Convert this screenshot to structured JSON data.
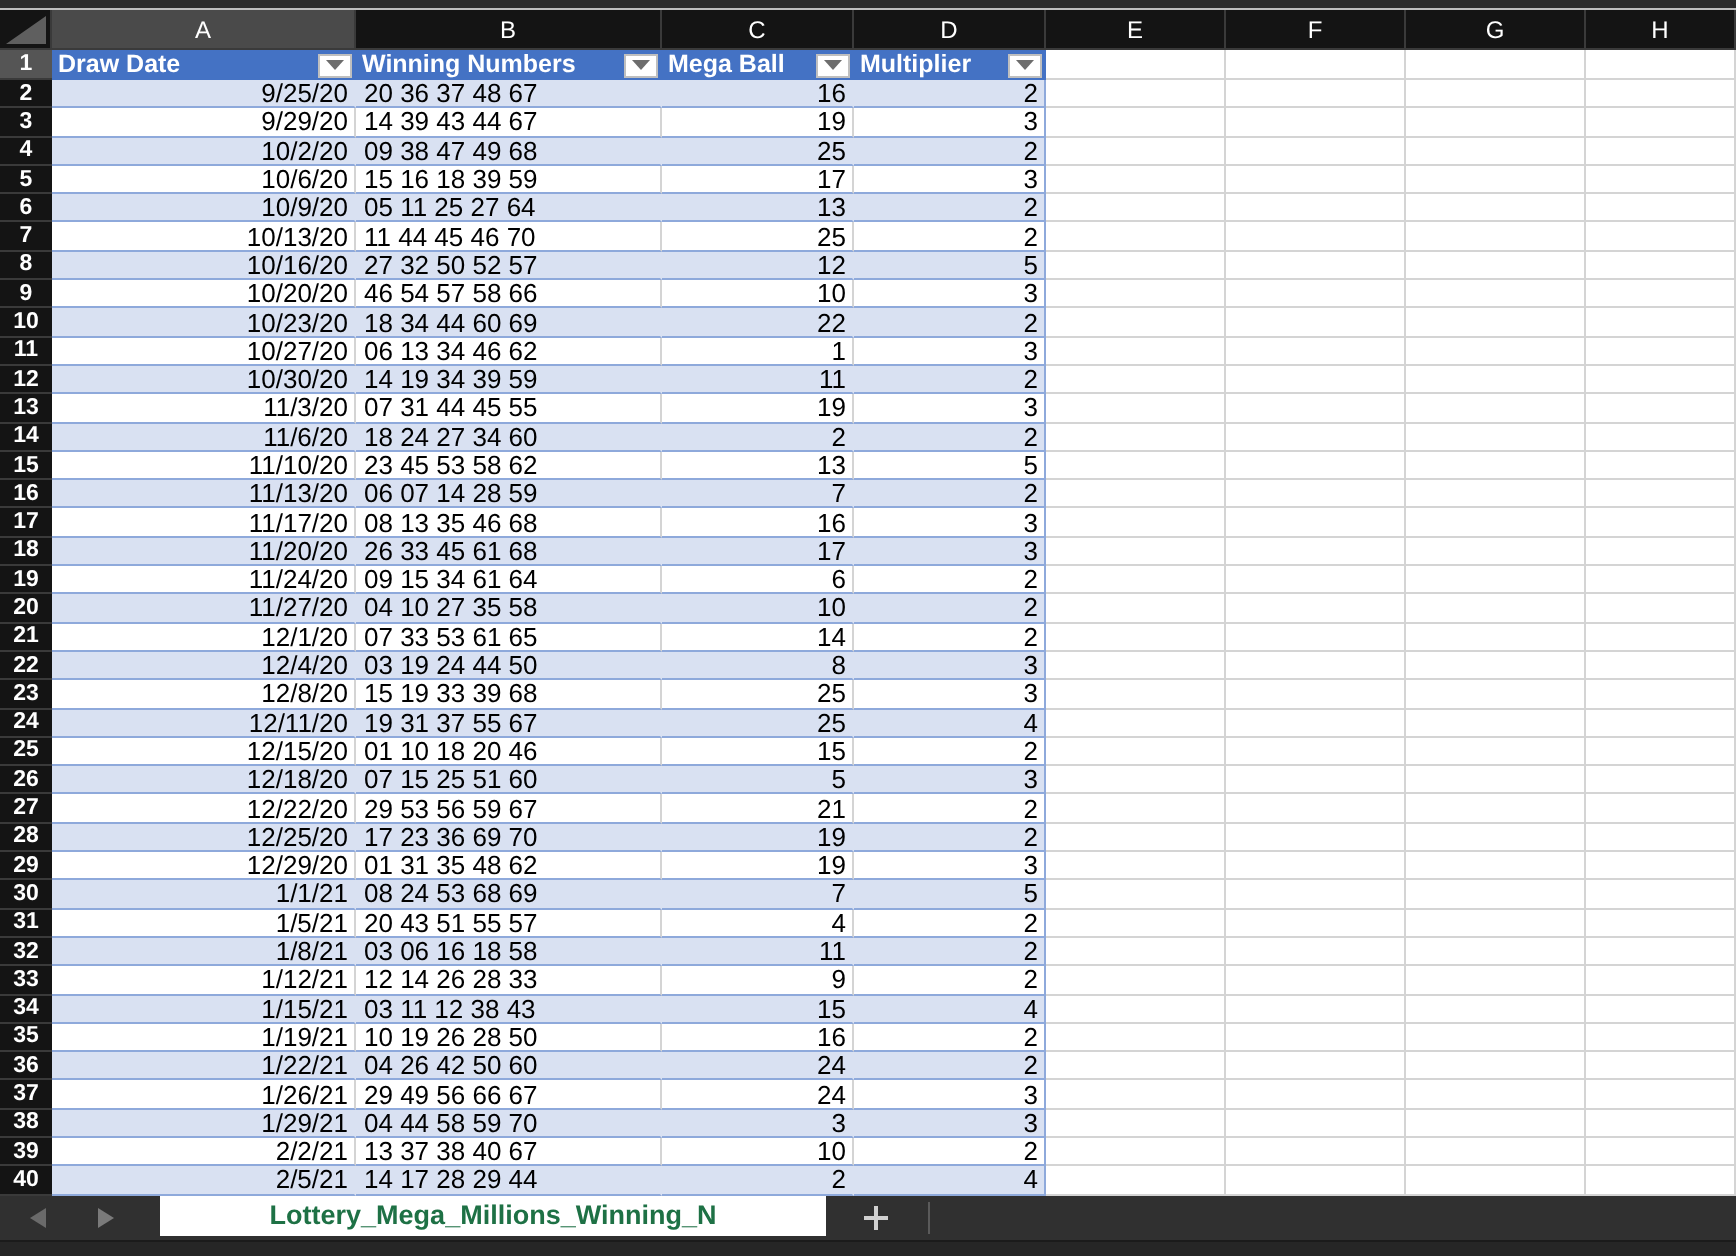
{
  "columns": [
    {
      "label": "A",
      "selected": true
    },
    {
      "label": "B",
      "selected": false
    },
    {
      "label": "C",
      "selected": false
    },
    {
      "label": "D",
      "selected": false
    },
    {
      "label": "E",
      "selected": false
    },
    {
      "label": "F",
      "selected": false
    },
    {
      "label": "G",
      "selected": false
    },
    {
      "label": "H",
      "selected": false
    }
  ],
  "row_headers": [
    {
      "label": "1",
      "selected": true
    },
    {
      "label": "2",
      "selected": false
    },
    {
      "label": "3",
      "selected": false
    },
    {
      "label": "4",
      "selected": false
    },
    {
      "label": "5",
      "selected": false
    },
    {
      "label": "6",
      "selected": false
    },
    {
      "label": "7",
      "selected": false
    },
    {
      "label": "8",
      "selected": false
    },
    {
      "label": "9",
      "selected": false
    },
    {
      "label": "10",
      "selected": false
    },
    {
      "label": "11",
      "selected": false
    },
    {
      "label": "12",
      "selected": false
    },
    {
      "label": "13",
      "selected": false
    },
    {
      "label": "14",
      "selected": false
    },
    {
      "label": "15",
      "selected": false
    },
    {
      "label": "16",
      "selected": false
    },
    {
      "label": "17",
      "selected": false
    },
    {
      "label": "18",
      "selected": false
    },
    {
      "label": "19",
      "selected": false
    },
    {
      "label": "20",
      "selected": false
    },
    {
      "label": "21",
      "selected": false
    },
    {
      "label": "22",
      "selected": false
    },
    {
      "label": "23",
      "selected": false
    },
    {
      "label": "24",
      "selected": false
    },
    {
      "label": "25",
      "selected": false
    },
    {
      "label": "26",
      "selected": false
    },
    {
      "label": "27",
      "selected": false
    },
    {
      "label": "28",
      "selected": false
    },
    {
      "label": "29",
      "selected": false
    },
    {
      "label": "30",
      "selected": false
    },
    {
      "label": "31",
      "selected": false
    },
    {
      "label": "32",
      "selected": false
    },
    {
      "label": "33",
      "selected": false
    },
    {
      "label": "34",
      "selected": false
    },
    {
      "label": "35",
      "selected": false
    },
    {
      "label": "36",
      "selected": false
    },
    {
      "label": "37",
      "selected": false
    },
    {
      "label": "38",
      "selected": false
    },
    {
      "label": "39",
      "selected": false
    },
    {
      "label": "40",
      "selected": false
    }
  ],
  "table": {
    "headers": [
      "Draw Date",
      "Winning Numbers",
      "Mega Ball",
      "Multiplier"
    ],
    "rows": [
      [
        "9/25/20",
        "20 36 37 48 67",
        "16",
        "2"
      ],
      [
        "9/29/20",
        "14 39 43 44 67",
        "19",
        "3"
      ],
      [
        "10/2/20",
        "09 38 47 49 68",
        "25",
        "2"
      ],
      [
        "10/6/20",
        "15 16 18 39 59",
        "17",
        "3"
      ],
      [
        "10/9/20",
        "05 11 25 27 64",
        "13",
        "2"
      ],
      [
        "10/13/20",
        "11 44 45 46 70",
        "25",
        "2"
      ],
      [
        "10/16/20",
        "27 32 50 52 57",
        "12",
        "5"
      ],
      [
        "10/20/20",
        "46 54 57 58 66",
        "10",
        "3"
      ],
      [
        "10/23/20",
        "18 34 44 60 69",
        "22",
        "2"
      ],
      [
        "10/27/20",
        "06 13 34 46 62",
        "1",
        "3"
      ],
      [
        "10/30/20",
        "14 19 34 39 59",
        "11",
        "2"
      ],
      [
        "11/3/20",
        "07 31 44 45 55",
        "19",
        "3"
      ],
      [
        "11/6/20",
        "18 24 27 34 60",
        "2",
        "2"
      ],
      [
        "11/10/20",
        "23 45 53 58 62",
        "13",
        "5"
      ],
      [
        "11/13/20",
        "06 07 14 28 59",
        "7",
        "2"
      ],
      [
        "11/17/20",
        "08 13 35 46 68",
        "16",
        "3"
      ],
      [
        "11/20/20",
        "26 33 45 61 68",
        "17",
        "3"
      ],
      [
        "11/24/20",
        "09 15 34 61 64",
        "6",
        "2"
      ],
      [
        "11/27/20",
        "04 10 27 35 58",
        "10",
        "2"
      ],
      [
        "12/1/20",
        "07 33 53 61 65",
        "14",
        "2"
      ],
      [
        "12/4/20",
        "03 19 24 44 50",
        "8",
        "3"
      ],
      [
        "12/8/20",
        "15 19 33 39 68",
        "25",
        "3"
      ],
      [
        "12/11/20",
        "19 31 37 55 67",
        "25",
        "4"
      ],
      [
        "12/15/20",
        "01 10 18 20 46",
        "15",
        "2"
      ],
      [
        "12/18/20",
        "07 15 25 51 60",
        "5",
        "3"
      ],
      [
        "12/22/20",
        "29 53 56 59 67",
        "21",
        "2"
      ],
      [
        "12/25/20",
        "17 23 36 69 70",
        "19",
        "2"
      ],
      [
        "12/29/20",
        "01 31 35 48 62",
        "19",
        "3"
      ],
      [
        "1/1/21",
        "08 24 53 68 69",
        "7",
        "5"
      ],
      [
        "1/5/21",
        "20 43 51 55 57",
        "4",
        "2"
      ],
      [
        "1/8/21",
        "03 06 16 18 58",
        "11",
        "2"
      ],
      [
        "1/12/21",
        "12 14 26 28 33",
        "9",
        "2"
      ],
      [
        "1/15/21",
        "03 11 12 38 43",
        "15",
        "4"
      ],
      [
        "1/19/21",
        "10 19 26 28 50",
        "16",
        "2"
      ],
      [
        "1/22/21",
        "04 26 42 50 60",
        "24",
        "2"
      ],
      [
        "1/26/21",
        "29 49 56 66 67",
        "24",
        "3"
      ],
      [
        "1/29/21",
        "04 44 58 59 70",
        "3",
        "3"
      ],
      [
        "2/2/21",
        "13 37 38 40 67",
        "10",
        "2"
      ],
      [
        "2/5/21",
        "14 17 28 29 44",
        "2",
        "4"
      ]
    ]
  },
  "sheet_tabs": [
    {
      "label": "Lottery_Mega_Millions_Winning_N",
      "selected": true
    }
  ]
}
